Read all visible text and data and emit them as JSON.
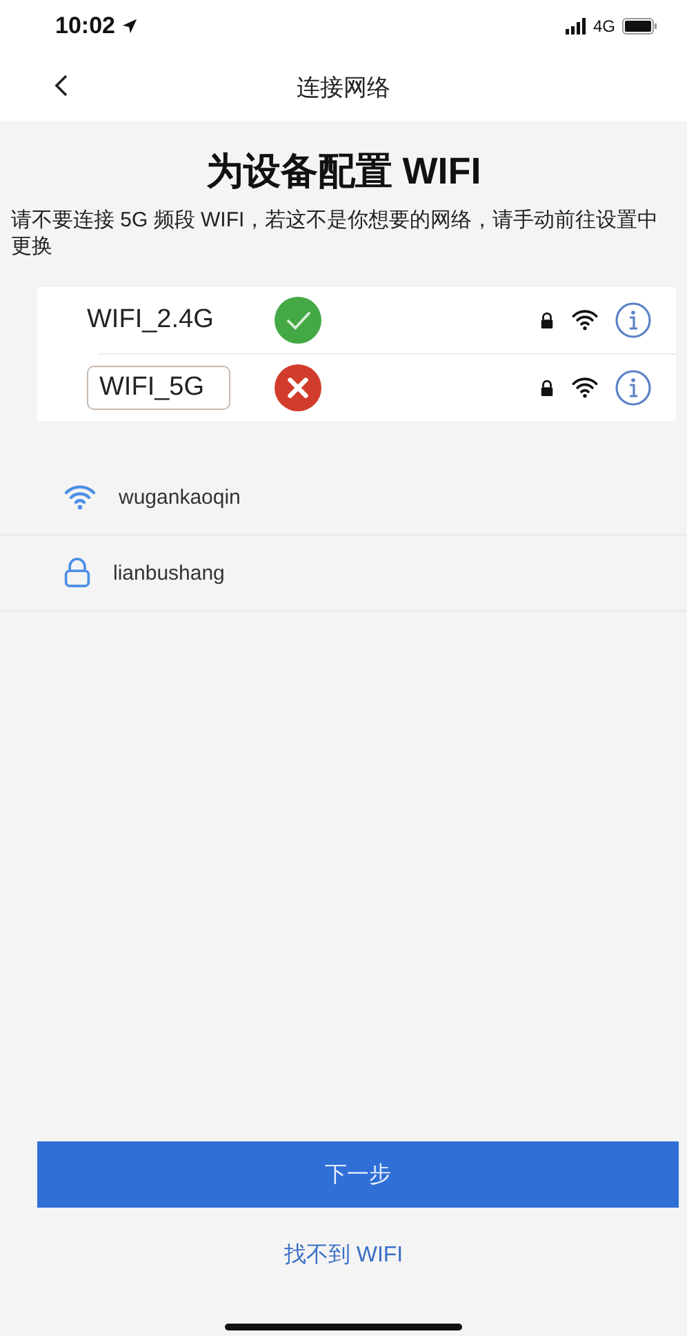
{
  "status_bar": {
    "time": "10:02",
    "network": "4G"
  },
  "nav": {
    "title": "连接网络"
  },
  "heading": "为设备配置 WIFI",
  "description": "请不要连接 5G 频段 WIFI，若这不是你想要的网络，请手动前往设置中更换",
  "examples": [
    {
      "name": "WIFI_2.4G",
      "kind": "ok",
      "outlined": false
    },
    {
      "name": "WIFI_5G",
      "kind": "bad",
      "outlined": true
    }
  ],
  "networks": [
    {
      "name": "wugankaoqin",
      "kind": "wifi"
    },
    {
      "name": "lianbushang",
      "kind": "locked"
    }
  ],
  "next_button": "下一步",
  "help_link": "找不到 WIFI"
}
